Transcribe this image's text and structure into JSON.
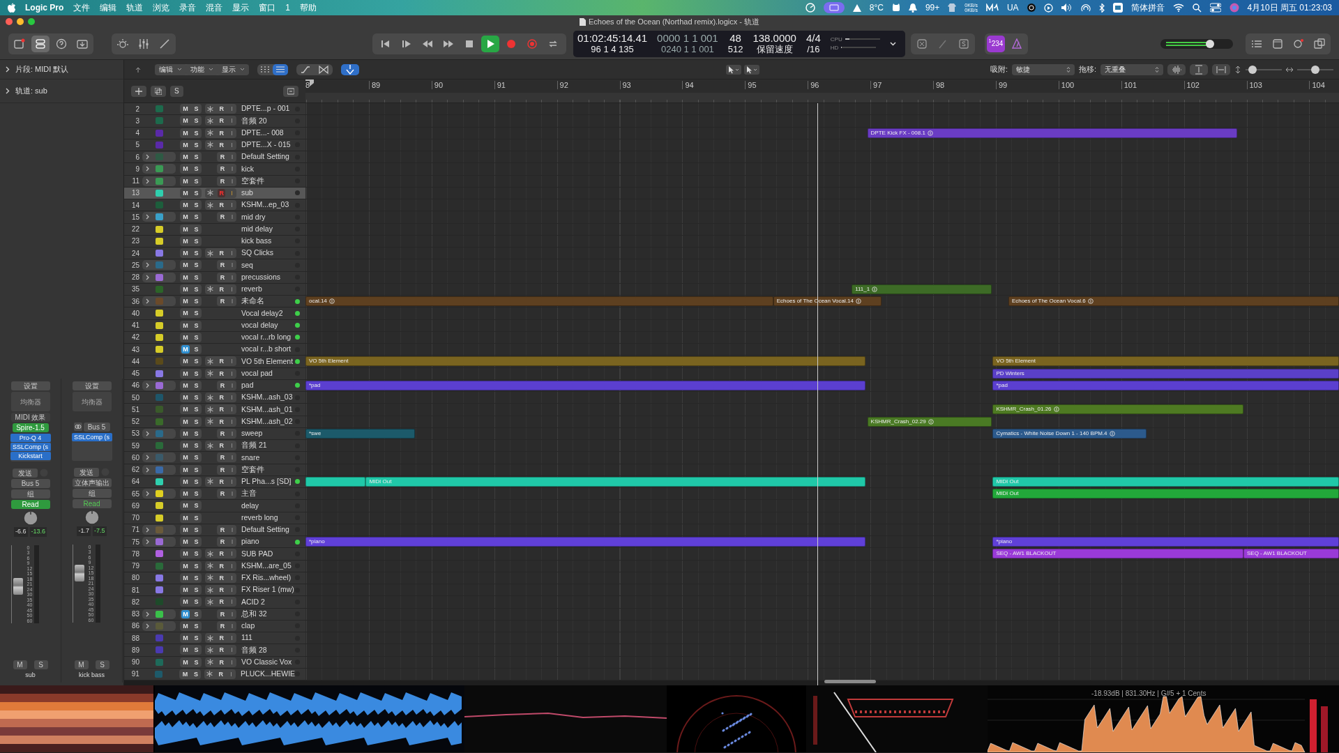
{
  "menu_bar": {
    "app": "Logic Pro",
    "items": [
      "文件",
      "编辑",
      "轨道",
      "浏览",
      "录音",
      "混音",
      "显示",
      "窗口",
      "1",
      "帮助"
    ],
    "status": {
      "temperature": "8°C",
      "notifications": "99+",
      "net_up": "0KB/s",
      "net_down": "0KB/s",
      "ua": "UA",
      "input_method": "简体拼音",
      "clock": "4月10日 周五 01:23:03"
    }
  },
  "window": {
    "title": "Echoes of the Ocean (Northad remix).logicx - 轨道"
  },
  "transport": {
    "playing": true,
    "cycle": false
  },
  "lcd": {
    "time": "01:02:45:14.41",
    "position": "96 1 4 135",
    "top_right": "0000 1 1 001",
    "bottom_right": "0240 1 1 001",
    "bars": "48",
    "buffer": "512",
    "tempo": "138.0000",
    "tempo_mode": "保留速度",
    "signature": "4/4",
    "division": "/16",
    "cpu": {
      "label": "CPU",
      "level": 0.12
    },
    "hd": {
      "label": "HD",
      "level": 0.02
    }
  },
  "count_in": {
    "label": "$^{1}$234",
    "on": true
  },
  "master_volume": {
    "level": 0.68
  },
  "inspector": {
    "region": "片段: MIDI 默认",
    "track": "轨道: sub"
  },
  "channel_strips": [
    {
      "setting": "设置",
      "eq": "均衡器",
      "midi_fx": "MIDI 效果",
      "input": {
        "label": "Spire-1.5",
        "kind": "instrument"
      },
      "plugins": [
        "Pro-Q 4",
        "SSLComp (s",
        "Kickstart"
      ],
      "sends": "发送",
      "output": "Bus 5",
      "group": "组",
      "automation": {
        "label": "Read",
        "on": true
      },
      "volume": "-6.6",
      "peak": "-13.6",
      "fader": {
        "level": 0.46
      },
      "scale": [
        "0",
        "3",
        "6",
        "9",
        "12",
        "15",
        "18",
        "21",
        "24",
        "30",
        "35",
        "40",
        "45",
        "50",
        "60"
      ],
      "mute": "M",
      "solo": "S",
      "name": "sub"
    },
    {
      "setting": "设置",
      "eq": "均衡器",
      "input": {
        "label": "Bus 5",
        "kind": "bus"
      },
      "plugins": [
        "SSLComp (s"
      ],
      "sends": "发送",
      "output": "立体声输出",
      "group": "组",
      "automation": {
        "label": "Read",
        "on": false
      },
      "volume": "-1.7",
      "peak": "-7.5",
      "fader": {
        "level": 0.66
      },
      "scale": [
        "0",
        "3",
        "6",
        "9",
        "12",
        "15",
        "18",
        "21",
        "24",
        "30",
        "35",
        "40",
        "45",
        "50",
        "60"
      ],
      "mute": "M",
      "solo": "S",
      "name": "kick bass"
    }
  ],
  "edit_toolbar": {
    "menus": [
      "编辑",
      "功能",
      "显示"
    ],
    "views": [
      {
        "selected": false
      },
      {
        "selected": true
      }
    ],
    "catch": true,
    "snap_label": "吸附:",
    "snap": "敏捷",
    "drag_label": "拖移:",
    "drag": "无重叠",
    "vzoom": {
      "level": 0.1
    },
    "hzoom": {
      "level": 0.5
    }
  },
  "track_header": {
    "solo_button": "S"
  },
  "ruler": {
    "labels": [
      "8",
      "89",
      "90",
      "91",
      "92",
      "93",
      "94",
      "95",
      "96",
      "97",
      "98",
      "99",
      "100",
      "101",
      "102",
      "103",
      "104"
    ]
  },
  "tracks": [
    {
      "number": "2",
      "name": "DPTE...p - 001",
      "kind": "audio",
      "color": "#1d6a4c",
      "m": "M",
      "s": "S",
      "r": "R",
      "i": "I",
      "muted": false,
      "selected": false,
      "armed": false,
      "active": false
    },
    {
      "number": "3",
      "name": "音频 20",
      "kind": "audio",
      "color": "#1d6a4c",
      "m": "M",
      "s": "S",
      "r": "R",
      "i": "I",
      "muted": false,
      "selected": false,
      "armed": false,
      "active": false
    },
    {
      "number": "4",
      "name": "DPTE...- 008",
      "kind": "audio",
      "color": "#5a2aa8",
      "m": "M",
      "s": "S",
      "r": "R",
      "i": "I",
      "muted": false,
      "selected": false,
      "armed": false,
      "active": false,
      "regions": [
        {
          "label": "DPTE Kick FX - 008.1",
          "color": "#6a3cc4",
          "loop": true
        }
      ]
    },
    {
      "number": "5",
      "name": "DPTE...X - 015",
      "kind": "audio",
      "color": "#5a2aa8",
      "m": "M",
      "s": "S",
      "r": "R",
      "i": "I",
      "muted": false,
      "selected": false,
      "armed": false,
      "active": false
    },
    {
      "number": "6",
      "name": "Default Setting",
      "kind": "stack",
      "color": "#2e5a44",
      "m": "M",
      "s": "S",
      "r": "R",
      "i": "I",
      "muted": false,
      "selected": false,
      "armed": false,
      "active": false
    },
    {
      "number": "9",
      "name": "kick",
      "kind": "stack",
      "color": "#3a9a55",
      "m": "M",
      "s": "S",
      "r": "R",
      "i": "I",
      "muted": false,
      "selected": false,
      "armed": false,
      "active": false
    },
    {
      "number": "11",
      "name": "空套件",
      "kind": "stack",
      "color": "#3a9a55",
      "m": "M",
      "s": "S",
      "r": "R",
      "i": "I",
      "muted": false,
      "selected": false,
      "armed": false,
      "active": false
    },
    {
      "number": "13",
      "name": "sub",
      "kind": "audio",
      "color": "#2fcfae",
      "m": "M",
      "s": "S",
      "r": "R",
      "i": "I",
      "muted": false,
      "selected": true,
      "armed": true,
      "active": false
    },
    {
      "number": "14",
      "name": "KSHM...ep_03",
      "kind": "audio",
      "color": "#1d5e3c",
      "m": "M",
      "s": "S",
      "r": "R",
      "i": "I",
      "muted": false,
      "selected": false,
      "armed": false,
      "active": false
    },
    {
      "number": "15",
      "name": "mid dry",
      "kind": "stack",
      "color": "#3aa0c8",
      "m": "M",
      "s": "S",
      "r": "R",
      "i": "I",
      "muted": false,
      "selected": false,
      "armed": false,
      "active": false
    },
    {
      "number": "22",
      "name": "mid delay",
      "kind": "aux",
      "color": "#d6cc28",
      "m": "M",
      "s": "S",
      "muted": false,
      "selected": false,
      "active": false
    },
    {
      "number": "23",
      "name": "kick bass",
      "kind": "aux",
      "color": "#d6cc28",
      "m": "M",
      "s": "S",
      "muted": false,
      "selected": false,
      "active": false
    },
    {
      "number": "24",
      "name": "SQ Clicks",
      "kind": "audio",
      "color": "#8878e4",
      "m": "M",
      "s": "S",
      "r": "R",
      "i": "I",
      "muted": false,
      "selected": false,
      "armed": false,
      "active": false
    },
    {
      "number": "25",
      "name": "seq",
      "kind": "stack",
      "color": "#2a6a8a",
      "m": "M",
      "s": "S",
      "r": "R",
      "i": "I",
      "muted": false,
      "selected": false,
      "armed": false,
      "active": false
    },
    {
      "number": "28",
      "name": "precussions",
      "kind": "stack",
      "color": "#9a6ad4",
      "m": "M",
      "s": "S",
      "r": "R",
      "i": "I",
      "muted": false,
      "selected": false,
      "armed": false,
      "active": false
    },
    {
      "number": "35",
      "name": "reverb",
      "kind": "audio",
      "color": "#2c6428",
      "m": "M",
      "s": "S",
      "r": "R",
      "i": "I",
      "muted": false,
      "selected": false,
      "armed": false,
      "active": false,
      "regions": [
        {
          "label": "111_1",
          "color": "#3d6b26",
          "loop": true
        }
      ]
    },
    {
      "number": "36",
      "name": "未命名",
      "kind": "stack",
      "color": "#6a4a2a",
      "m": "M",
      "s": "S",
      "r": "R",
      "i": "I",
      "muted": false,
      "selected": false,
      "armed": false,
      "active": true,
      "regions": [
        {
          "label": "ocal.14",
          "color": "#5e4020",
          "loop": true
        },
        {
          "label": "Echoes of The Ocean Vocal.14",
          "color": "#5e4020",
          "loop": true
        },
        {
          "label": "Echoes of The Ocean Vocal.6",
          "color": "#5e4020",
          "loop": true
        }
      ]
    },
    {
      "number": "40",
      "name": "Vocal delay2",
      "kind": "aux",
      "color": "#d6cc28",
      "m": "M",
      "s": "S",
      "muted": false,
      "selected": false,
      "active": true
    },
    {
      "number": "41",
      "name": "vocal delay",
      "kind": "aux",
      "color": "#d6cc28",
      "m": "M",
      "s": "S",
      "muted": false,
      "selected": false,
      "active": true
    },
    {
      "number": "42",
      "name": "vocal r...rb long",
      "kind": "aux",
      "color": "#d6cc28",
      "m": "M",
      "s": "S",
      "muted": false,
      "selected": false,
      "active": true
    },
    {
      "number": "43",
      "name": "vocal r...b short",
      "kind": "aux",
      "color": "#d6cc28",
      "m": "M",
      "s": "S",
      "muted": true,
      "selected": false,
      "active": false
    },
    {
      "number": "44",
      "name": "VO 5th Element",
      "kind": "audio",
      "color": "#5a4a1a",
      "m": "M",
      "s": "S",
      "r": "R",
      "i": "I",
      "muted": false,
      "selected": false,
      "armed": false,
      "active": true,
      "regions": [
        {
          "label": "VO 5th Element",
          "color": "#7a6420"
        },
        {
          "label": "VO 5th Element",
          "color": "#7a6420"
        }
      ]
    },
    {
      "number": "45",
      "name": "vocal pad",
      "kind": "audio",
      "color": "#8878e4",
      "m": "M",
      "s": "S",
      "r": "R",
      "i": "I",
      "muted": false,
      "selected": false,
      "armed": false,
      "active": false,
      "regions": [
        {
          "label": "PD Winters",
          "color": "#5a40c8"
        }
      ]
    },
    {
      "number": "46",
      "name": "pad",
      "kind": "stack",
      "color": "#9a6ad4",
      "m": "M",
      "s": "S",
      "r": "R",
      "i": "I",
      "muted": false,
      "selected": false,
      "armed": false,
      "active": true,
      "regions": [
        {
          "label": "*pad",
          "color": "#5b3fd0"
        },
        {
          "label": "*pad",
          "color": "#5b3fd0"
        }
      ]
    },
    {
      "number": "50",
      "name": "KSHM...ash_03",
      "kind": "audio",
      "color": "#1e566a",
      "m": "M",
      "s": "S",
      "r": "R",
      "i": "I",
      "muted": false,
      "selected": false,
      "armed": false,
      "active": false
    },
    {
      "number": "51",
      "name": "KSHM...ash_01",
      "kind": "audio",
      "color": "#3a5a2a",
      "m": "M",
      "s": "S",
      "r": "R",
      "i": "I",
      "muted": false,
      "selected": false,
      "armed": false,
      "active": false,
      "regions": [
        {
          "label": "KSHMR_Crash_01.26",
          "color": "#4e7a22",
          "loop": true
        }
      ]
    },
    {
      "number": "52",
      "name": "KSHM...ash_02",
      "kind": "audio",
      "color": "#3a6a2a",
      "m": "M",
      "s": "S",
      "r": "R",
      "i": "I",
      "muted": false,
      "selected": false,
      "armed": false,
      "active": false,
      "regions": [
        {
          "label": "KSHMR_Crash_02.29",
          "color": "#4a7a24",
          "loop": true
        }
      ]
    },
    {
      "number": "53",
      "name": "sweep",
      "kind": "stack",
      "color": "#2a6a8a",
      "m": "M",
      "s": "S",
      "r": "R",
      "i": "I",
      "muted": false,
      "selected": false,
      "armed": false,
      "active": false,
      "regions": [
        {
          "label": "*swe",
          "color": "#1c5a6a"
        },
        {
          "label": "Cymatics - White Noise Down 1 - 140 BPM.4",
          "color": "#2c5a8c",
          "loop": true
        }
      ]
    },
    {
      "number": "59",
      "name": "音频 21",
      "kind": "audio",
      "color": "#2a6a3a",
      "m": "M",
      "s": "S",
      "r": "R",
      "i": "I",
      "muted": false,
      "selected": false,
      "armed": false,
      "active": false
    },
    {
      "number": "60",
      "name": "snare",
      "kind": "stack",
      "color": "#3a5a6a",
      "m": "M",
      "s": "S",
      "r": "R",
      "i": "I",
      "muted": false,
      "selected": false,
      "armed": false,
      "active": false
    },
    {
      "number": "62",
      "name": "空套件",
      "kind": "stack",
      "color": "#3a6aa8",
      "m": "M",
      "s": "S",
      "r": "R",
      "i": "I",
      "muted": false,
      "selected": false,
      "armed": false,
      "active": false
    },
    {
      "number": "64",
      "name": "PL Pha...s [SD]",
      "kind": "audio",
      "color": "#2fcfae",
      "m": "M",
      "s": "S",
      "r": "R",
      "i": "I",
      "muted": false,
      "selected": false,
      "armed": false,
      "active": true,
      "regions": [
        {
          "color": "#20c8a8"
        },
        {
          "label": "MIDI Out",
          "color": "#20c8a8"
        },
        {
          "label": "MIDI Out",
          "color": "#20c8a8"
        }
      ]
    },
    {
      "number": "65",
      "name": "主音",
      "kind": "stack",
      "color": "#e0d020",
      "m": "M",
      "s": "S",
      "r": "R",
      "i": "I",
      "muted": false,
      "selected": false,
      "armed": false,
      "active": false,
      "regions": [
        {
          "label": "MIDI Out",
          "color": "#22a83a"
        }
      ]
    },
    {
      "number": "69",
      "name": "delay",
      "kind": "aux",
      "color": "#d6cc28",
      "m": "M",
      "s": "S",
      "muted": false,
      "selected": false,
      "active": false
    },
    {
      "number": "70",
      "name": "reverb long",
      "kind": "aux",
      "color": "#d6cc28",
      "m": "M",
      "s": "S",
      "muted": false,
      "selected": false,
      "active": false
    },
    {
      "number": "71",
      "name": "Default Setting",
      "kind": "stack",
      "color": "#6a5a3a",
      "m": "M",
      "s": "S",
      "r": "R",
      "i": "I",
      "muted": false,
      "selected": false,
      "armed": false,
      "active": false
    },
    {
      "number": "75",
      "name": "piano",
      "kind": "stack",
      "color": "#9a6ad4",
      "m": "M",
      "s": "S",
      "r": "R",
      "i": "I",
      "muted": false,
      "selected": false,
      "armed": false,
      "active": true,
      "regions": [
        {
          "label": "*piano",
          "color": "#6040d8"
        },
        {
          "label": "*piano",
          "color": "#6040d8"
        }
      ]
    },
    {
      "number": "78",
      "name": "SUB PAD",
      "kind": "audio",
      "color": "#b060e0",
      "m": "M",
      "s": "S",
      "r": "R",
      "i": "I",
      "muted": false,
      "selected": false,
      "armed": false,
      "active": false,
      "regions": [
        {
          "label": "SEQ - AW1 BLACKOUT",
          "color": "#9a3ad8"
        },
        {
          "label": "SEQ - AW1 BLACKOUT",
          "color": "#9a3ad8"
        }
      ]
    },
    {
      "number": "79",
      "name": "KSHM...are_05",
      "kind": "audio",
      "color": "#2a6a3a",
      "m": "M",
      "s": "S",
      "r": "R",
      "i": "I",
      "muted": false,
      "selected": false,
      "armed": false,
      "active": false
    },
    {
      "number": "80",
      "name": "FX Ris...wheel)",
      "kind": "audio",
      "color": "#8878e4",
      "m": "M",
      "s": "S",
      "r": "R",
      "i": "I",
      "muted": false,
      "selected": false,
      "armed": false,
      "active": false
    },
    {
      "number": "81",
      "name": "FX Riser 1 (mw)",
      "kind": "audio",
      "color": "#8878e4",
      "m": "M",
      "s": "S",
      "r": "R",
      "i": "I",
      "muted": false,
      "selected": false,
      "armed": false,
      "active": false
    },
    {
      "number": "82",
      "name": "ACID 2",
      "kind": "audio",
      "color": "#1e4a2a",
      "m": "M",
      "s": "S",
      "r": "R",
      "i": "I",
      "muted": false,
      "selected": false,
      "armed": false,
      "active": false
    },
    {
      "number": "83",
      "name": "总和 32",
      "kind": "stack",
      "color": "#3ac04a",
      "m": "M",
      "s": "S",
      "r": "R",
      "i": "I",
      "muted": true,
      "selected": false,
      "armed": false,
      "active": false
    },
    {
      "number": "86",
      "name": "clap",
      "kind": "stack",
      "color": "#5a5a3a",
      "m": "M",
      "s": "S",
      "r": "R",
      "i": "I",
      "muted": false,
      "selected": false,
      "armed": false,
      "active": false
    },
    {
      "number": "88",
      "name": "111",
      "kind": "audio",
      "color": "#4a3ab0",
      "m": "M",
      "s": "S",
      "r": "R",
      "i": "I",
      "muted": false,
      "selected": false,
      "armed": false,
      "active": false
    },
    {
      "number": "89",
      "name": "音频 28",
      "kind": "audio",
      "color": "#4a3ab0",
      "m": "M",
      "s": "S",
      "r": "R",
      "i": "I",
      "muted": false,
      "selected": false,
      "armed": false,
      "active": false
    },
    {
      "number": "90",
      "name": "VO Classic Vox",
      "kind": "audio",
      "color": "#1e6a5a",
      "m": "M",
      "s": "S",
      "r": "R",
      "i": "I",
      "muted": false,
      "selected": false,
      "armed": false,
      "active": false
    },
    {
      "number": "91",
      "name": "PLUCK...HEWIE",
      "kind": "audio",
      "color": "#1e5a6a",
      "m": "M",
      "s": "S",
      "r": "R",
      "i": "I",
      "muted": false,
      "selected": false,
      "armed": false,
      "active": false
    }
  ],
  "analyzer": {
    "readout": "-18.93dB | 831.30Hz | G#5 + 1 Cents"
  }
}
